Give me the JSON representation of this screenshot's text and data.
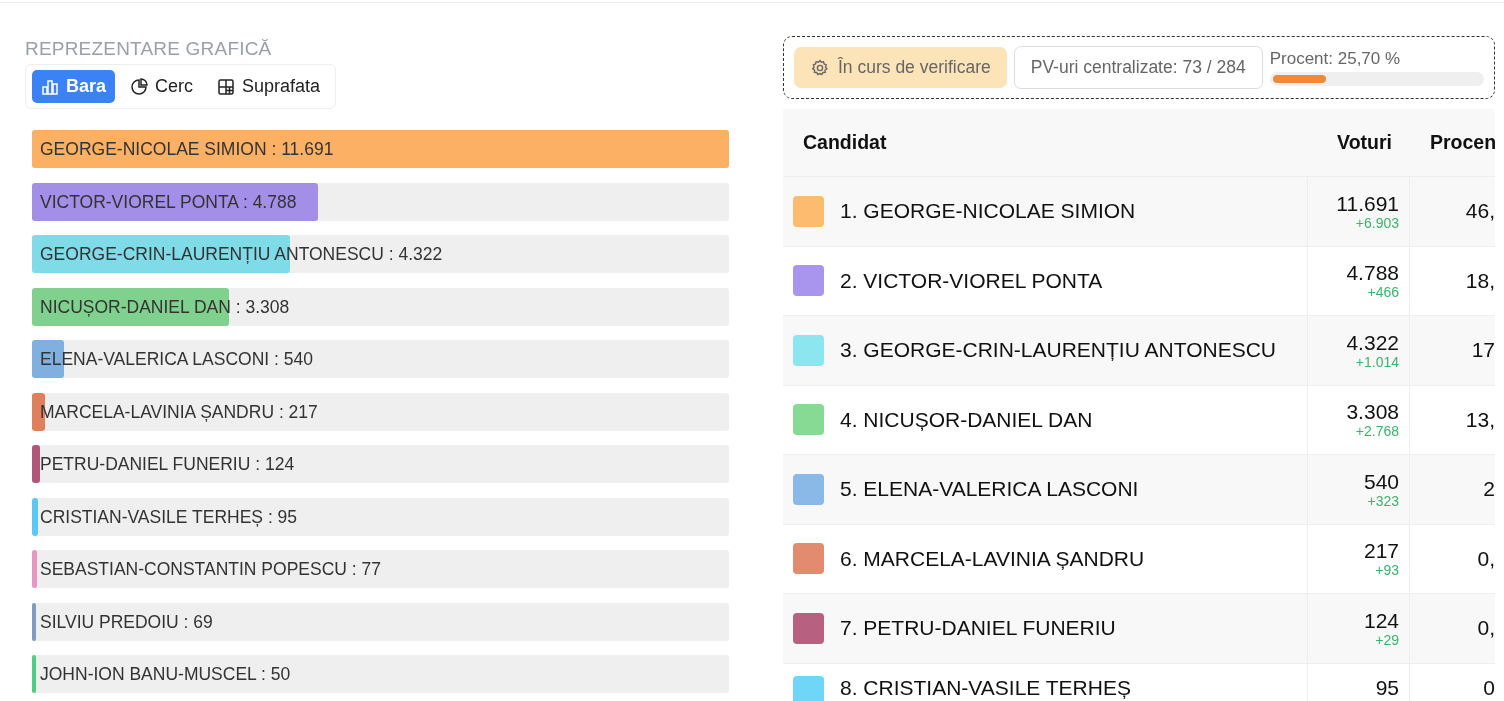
{
  "chart_panel": {
    "title": "REPREZENTARE GRAFICĂ",
    "tabs": [
      {
        "label": "Bara",
        "selected": true
      },
      {
        "label": "Cerc",
        "selected": false
      },
      {
        "label": "Suprafata",
        "selected": false
      }
    ],
    "bars": [
      {
        "label": "GEORGE-NICOLAE SIMION : 11.691",
        "level": 1,
        "color": "#fbb063"
      },
      {
        "label": "VICTOR-VIOREL PONTA : 4.788",
        "level": 0.41,
        "color": "#a38ee8"
      },
      {
        "label": "GEORGE-CRIN-LAURENȚIU ANTONESCU : 4.322",
        "level": 0.37,
        "color": "#7fdbe8"
      },
      {
        "label": "NICUȘOR-DANIEL DAN : 3.308",
        "level": 0.283,
        "color": "#7fd18d"
      },
      {
        "label": "ELENA-VALERICA LASCONI : 540",
        "level": 0.046,
        "color": "#7fb0e0"
      },
      {
        "label": "MARCELA-LAVINIA ȘANDRU : 217",
        "level": 0.019,
        "color": "#e07f5c"
      },
      {
        "label": "PETRU-DANIEL FUNERIU : 124",
        "level": 0.011,
        "color": "#b0567a"
      },
      {
        "label": "CRISTIAN-VASILE TERHEȘ : 95",
        "level": 0.008,
        "color": "#5cc8f5"
      },
      {
        "label": "SEBASTIAN-CONSTANTIN POPESCU : 77",
        "level": 0.007,
        "color": "#e897c0"
      },
      {
        "label": "SILVIU PREDOIU : 69",
        "level": 0.006,
        "color": "#7f9cc0"
      },
      {
        "label": "JOHN-ION BANU-MUSCEL : 50",
        "level": 0.004,
        "color": "#4ccf7f"
      }
    ]
  },
  "status": {
    "state": "În curs de verificare",
    "centralized": "PV-uri centralizate: 73 / 284",
    "percent_label": "Procent: 25,70 %",
    "level": 0.257
  },
  "table": {
    "columns": [
      "Candidat",
      "Voturi",
      "Procen"
    ],
    "rows": [
      {
        "name": "1. GEORGE-NICOLAE SIMION",
        "color": "#fdbb6f",
        "votes": "11.691",
        "delta": "+6.903",
        "percent": "46,"
      },
      {
        "name": "2. VICTOR-VIOREL PONTA",
        "color": "#a995ee",
        "votes": "4.788",
        "delta": "+466",
        "percent": "18,"
      },
      {
        "name": "3. GEORGE-CRIN-LAURENȚIU ANTONESCU",
        "color": "#8ce6f0",
        "votes": "4.322",
        "delta": "+1.014",
        "percent": "17"
      },
      {
        "name": "4. NICUȘOR-DANIEL DAN",
        "color": "#86da93",
        "votes": "3.308",
        "delta": "+2.768",
        "percent": "13,"
      },
      {
        "name": "5. ELENA-VALERICA LASCONI",
        "color": "#8ab9e8",
        "votes": "540",
        "delta": "+323",
        "percent": "2"
      },
      {
        "name": "6. MARCELA-LAVINIA ȘANDRU",
        "color": "#e28b6e",
        "votes": "217",
        "delta": "+93",
        "percent": "0,"
      },
      {
        "name": "7. PETRU-DANIEL FUNERIU",
        "color": "#b8607f",
        "votes": "124",
        "delta": "+29",
        "percent": "0,"
      },
      {
        "name": "8. CRISTIAN-VASILE TERHEȘ",
        "color": "#6fd6f8",
        "votes": "95",
        "percent": "0"
      }
    ]
  }
}
